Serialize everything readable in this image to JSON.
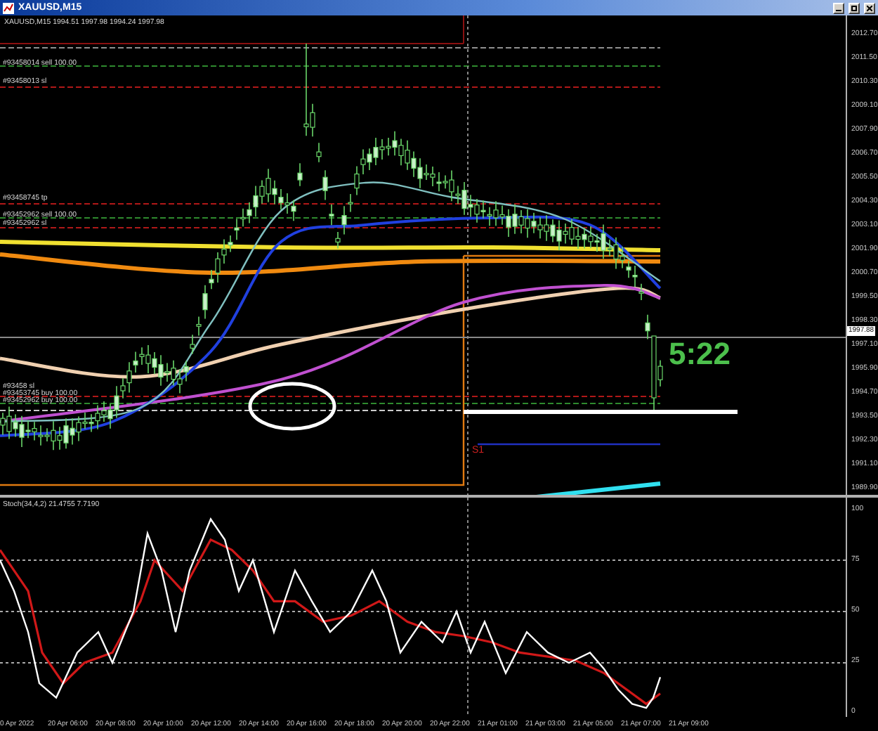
{
  "window": {
    "title": "XAUUSD,M15"
  },
  "chart": {
    "symbol_info": "XAUUSD,M15  1994.51 1997.98 1994.24 1997.98",
    "order_labels": [
      {
        "text": "#93458014 sell 100.00"
      },
      {
        "text": "#93458013 sl"
      },
      {
        "text": "#93458745 tp"
      },
      {
        "text": "#93452962 sell 100.00"
      },
      {
        "text": "#93452962 sl"
      },
      {
        "text": "#93458 sl"
      },
      {
        "text": "#93453745 buy 100.00"
      },
      {
        "text": "#93452962 buy 100.00"
      }
    ],
    "pivot_label": "S1",
    "countdown": "5:22",
    "current_price": "1997.88",
    "price_axis": [
      "2012.70",
      "2011.50",
      "2010.30",
      "2009.10",
      "2007.90",
      "2006.70",
      "2005.50",
      "2004.30",
      "2003.10",
      "2001.90",
      "2000.70",
      "1999.50",
      "1998.30",
      "1997.10",
      "1995.90",
      "1994.70",
      "1993.50",
      "1992.30",
      "1991.10",
      "1989.90"
    ]
  },
  "stochastic": {
    "label": "Stoch(34,4,2) 21.4755 7.7190",
    "axis": [
      "100",
      "75",
      "50",
      "25",
      "0"
    ]
  },
  "time_axis": [
    "0 Apr 2022",
    "20 Apr 06:00",
    "20 Apr 08:00",
    "20 Apr 10:00",
    "20 Apr 12:00",
    "20 Apr 14:00",
    "20 Apr 16:00",
    "20 Apr 18:00",
    "20 Apr 20:00",
    "20 Apr 22:00",
    "21 Apr 01:00",
    "21 Apr 03:00",
    "21 Apr 05:00",
    "21 Apr 07:00",
    "21 Apr 09:00"
  ]
}
